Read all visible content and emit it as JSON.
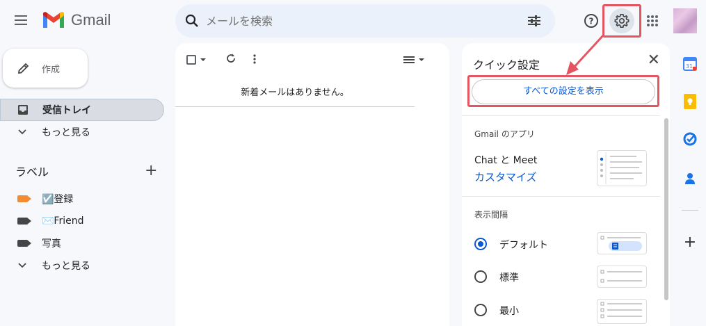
{
  "header": {
    "logo_text": "Gmail",
    "search_placeholder": "メールを検索",
    "tooltip": "設定"
  },
  "sidebar": {
    "compose_label": "作成",
    "inbox_label": "受信トレイ",
    "more_label": "もっと見る",
    "labels_title": "ラベル",
    "labels": [
      {
        "label": "☑️登録",
        "color": "#f28b33"
      },
      {
        "label": "✉️Friend",
        "color": "#444746"
      },
      {
        "label": "写真",
        "color": "#444746"
      }
    ],
    "labels_more": "もっと見る"
  },
  "main": {
    "empty_message": "新着メールはありません。"
  },
  "quick_settings": {
    "title": "クイック設定",
    "all_settings_button": "すべての設定を表示",
    "apps_section": "Gmail のアプリ",
    "chat_meet": "Chat と Meet",
    "customize_link": "カスタマイズ",
    "density_section": "表示間隔",
    "density_options": [
      {
        "label": "デフォルト",
        "selected": true
      },
      {
        "label": "標準",
        "selected": false
      },
      {
        "label": "最小",
        "selected": false
      }
    ]
  },
  "colors": {
    "accent": "#0b57d0",
    "highlight": "#e45562",
    "background": "#f6f8fc"
  }
}
